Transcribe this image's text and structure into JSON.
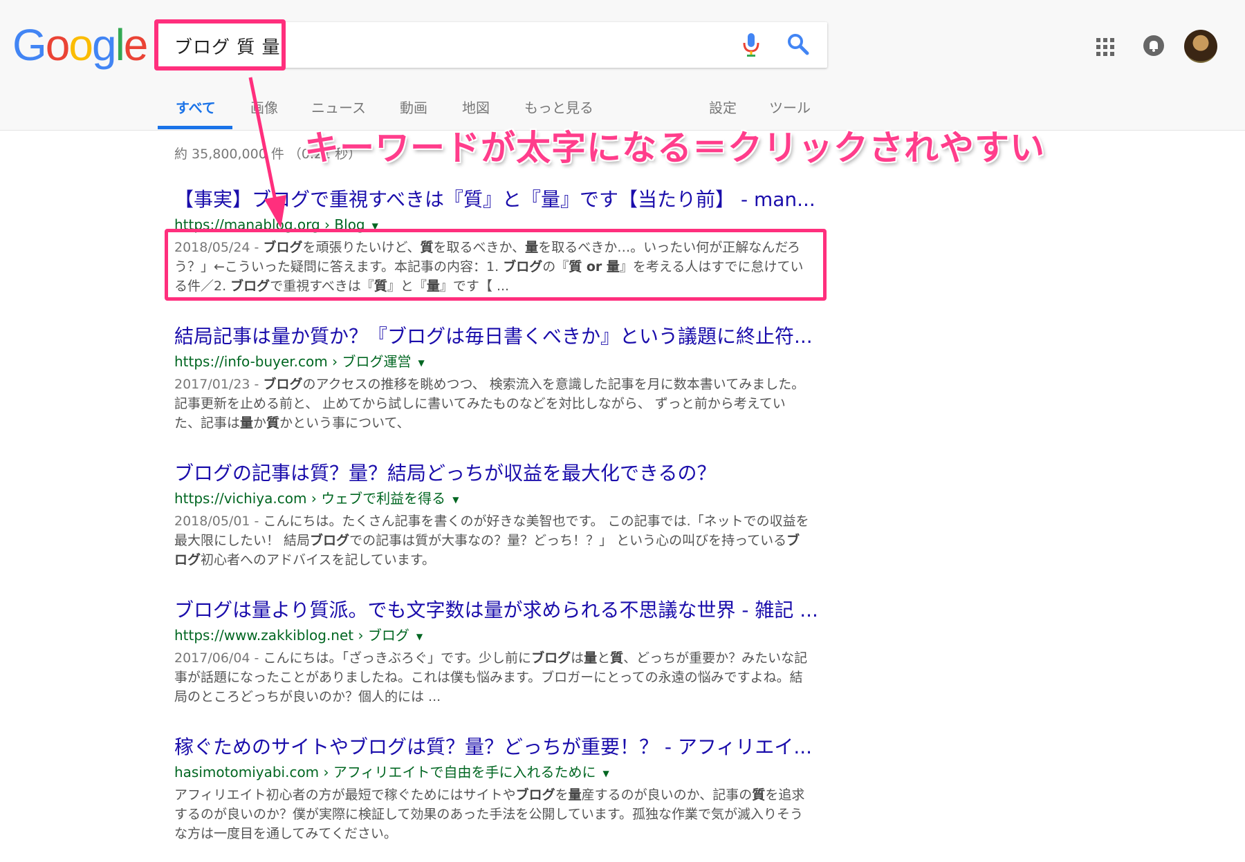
{
  "header": {
    "logo_letters": [
      {
        "ch": "G",
        "color": "#4285F4"
      },
      {
        "ch": "o",
        "color": "#EA4335"
      },
      {
        "ch": "o",
        "color": "#FBBC05"
      },
      {
        "ch": "g",
        "color": "#4285F4"
      },
      {
        "ch": "l",
        "color": "#34A853"
      },
      {
        "ch": "e",
        "color": "#EA4335"
      }
    ],
    "search": {
      "query": "ブログ 質 量",
      "mic_icon": "microphone-icon",
      "search_icon": "magnifier-icon"
    },
    "tabs": [
      {
        "label": "すべて",
        "active": true
      },
      {
        "label": "画像"
      },
      {
        "label": "ニュース"
      },
      {
        "label": "動画"
      },
      {
        "label": "地図"
      },
      {
        "label": "もっと見る"
      },
      {
        "label": "設定"
      },
      {
        "label": "ツール"
      }
    ],
    "icons": [
      "apps-grid-icon",
      "notification-bell-icon",
      "account-avatar"
    ]
  },
  "stats": "約 35,800,000 件 （0.21 秒）",
  "annotation": "キーワードが太字になる＝クリックされやすい",
  "results": [
    {
      "title": "【事実】ブログで重視すべきは『質』と『量』です【当たり前】 - man...",
      "url": "https://manablog.org › Blog",
      "date": "2018/05/24 - ",
      "snippet_parts": [
        {
          "t": "ブログ",
          "b": true
        },
        {
          "t": "を頑張りたいけど、"
        },
        {
          "t": "質",
          "b": true
        },
        {
          "t": "を取るべきか、"
        },
        {
          "t": "量",
          "b": true
        },
        {
          "t": "を取るべきか…。いったい何が正解なんだろう？」←こういった疑問に答えます。本記事の内容：1. "
        },
        {
          "t": "ブログ",
          "b": true
        },
        {
          "t": "の『"
        },
        {
          "t": "質 or 量",
          "b": true
        },
        {
          "t": "』を考える人はすでに怠けている件／2. "
        },
        {
          "t": "ブログ",
          "b": true
        },
        {
          "t": "で重視すべきは『"
        },
        {
          "t": "質",
          "b": true
        },
        {
          "t": "』と『"
        },
        {
          "t": "量",
          "b": true
        },
        {
          "t": "』です【 ..."
        }
      ]
    },
    {
      "title": "結局記事は量か質か？『ブログは毎日書くべきか』という議題に終止符...",
      "url": "https://info-buyer.com › ブログ運営",
      "date": "2017/01/23 - ",
      "snippet_parts": [
        {
          "t": "ブログ",
          "b": true
        },
        {
          "t": "のアクセスの推移を眺めつつ、 検索流入を意識した記事を月に数本書いてみました。 記事更新を止める前と、 止めてから試しに書いてみたものなどを対比しながら、 ずっと前から考えていた、記事は"
        },
        {
          "t": "量",
          "b": true
        },
        {
          "t": "か"
        },
        {
          "t": "質",
          "b": true
        },
        {
          "t": "かという事について、"
        }
      ]
    },
    {
      "title": "ブログの記事は質？量？結局どっちが収益を最大化できるの？",
      "url": "https://vichiya.com › ウェブで利益を得る",
      "date": "2018/05/01 - ",
      "snippet_parts": [
        {
          "t": "こんにちは。たくさん記事を書くのが好きな美智也です。 この記事では.「ネットでの収益を最大限にしたい！ 結局"
        },
        {
          "t": "ブログ",
          "b": true
        },
        {
          "t": "での記事は質が大事なの？量？どっち！？」 という心の叫びを持っている"
        },
        {
          "t": "ブログ",
          "b": true
        },
        {
          "t": "初心者へのアドバイスを記しています。"
        }
      ]
    },
    {
      "title": "ブログは量より質派。でも文字数は量が求められる不思議な世界 - 雑記 ...",
      "url": "https://www.zakkiblog.net › ブログ",
      "date": "2017/06/04 - ",
      "snippet_parts": [
        {
          "t": "こんにちは。「ざっきぶろぐ」です。少し前に"
        },
        {
          "t": "ブログ",
          "b": true
        },
        {
          "t": "は"
        },
        {
          "t": "量",
          "b": true
        },
        {
          "t": "と"
        },
        {
          "t": "質",
          "b": true
        },
        {
          "t": "、どっちが重要か？みたいな記事が話題になったことがありましたね。これは僕も悩みます。ブロガーにとっての永遠の悩みですよね。結局のところどっちが良いのか？個人的には ..."
        }
      ]
    },
    {
      "title": "稼ぐためのサイトやブログは質？量？どっちが重要！？ - アフィリエイ...",
      "url": "hasimotomiyabi.com › アフィリエイトで自由を手に入れるために",
      "date": "",
      "snippet_parts": [
        {
          "t": "アフィリエイト初心者の方が最短で稼ぐためにはサイトや"
        },
        {
          "t": "ブログ",
          "b": true
        },
        {
          "t": "を"
        },
        {
          "t": "量",
          "b": true
        },
        {
          "t": "産するのが良いのか、記事の"
        },
        {
          "t": "質",
          "b": true
        },
        {
          "t": "を追求するのが良いのか？僕が実際に検証して効果のあった手法を公開しています。孤独な作業で気が滅入りそうな方は一度目を通してみてください。"
        }
      ]
    }
  ],
  "colors": {
    "annotation": "#ff2f7d",
    "link": "#1a0dab",
    "url": "#006621",
    "active_tab": "#1a73e8"
  }
}
